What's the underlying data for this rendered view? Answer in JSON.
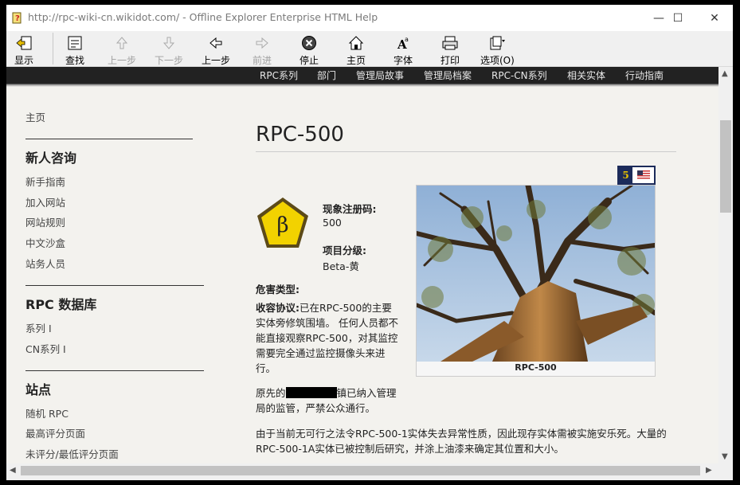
{
  "window": {
    "title": "http://rpc-wiki-cn.wikidot.com/ - Offline Explorer Enterprise HTML Help",
    "controls": [
      "—",
      "☐",
      "✕"
    ]
  },
  "toolbar": {
    "show": "显示",
    "find": "查找",
    "prev_step": "上一步",
    "next_step": "下一步",
    "back": "上一步",
    "forward": "前进",
    "stop": "停止",
    "home": "主页",
    "font": "字体",
    "print": "打印",
    "options": "选项(O)"
  },
  "nav": [
    "RPC系列",
    "部门",
    "管理局故事",
    "管理局档案",
    "RPC-CN系列",
    "相关实体",
    "行动指南"
  ],
  "sidebar": {
    "home": "主页",
    "newbie_head": "新人咨询",
    "newbie_items": [
      "新手指南",
      "加入网站",
      "网站规则",
      "中文沙盒",
      "站务人员"
    ],
    "db_head": "RPC 数据库",
    "db_items": [
      "系列 I",
      "CN系列 I"
    ],
    "site_head": "站点",
    "site_items": [
      "随机 RPC",
      "最高评分页面",
      "未评分/最低评分页面"
    ]
  },
  "article": {
    "title": "RPC-500",
    "rating": "5",
    "badge_symbol": "β",
    "reg_label": "现象注册码:",
    "reg_value": "500",
    "class_label": "项目分级:",
    "class_value": "Beta-黄",
    "hazard_label": "危害类型:",
    "containment_label": "收容协议:",
    "containment_text": "已在RPC-500的主要实体旁修筑围墙。 任何人员都不能直接观察RPC-500，对其监控需要完全通过监控摄像头来进行。",
    "orig_before": "原先的",
    "orig_after": "镇已纳入管理局的监管，严禁公众通行。",
    "para2": "由于当前无可行之法令RPC-500-1实体失去异常性质，因此现存实体需被实施安乐死。大量的RPC-500-1A实体已被控制后研究，并涂上油漆来确定其位置和大小。",
    "image_caption": "RPC-500"
  },
  "colors": {
    "navbar": "#222222",
    "badge_yellow": "#f2d200",
    "rating_navy": "#1c2b5a"
  }
}
